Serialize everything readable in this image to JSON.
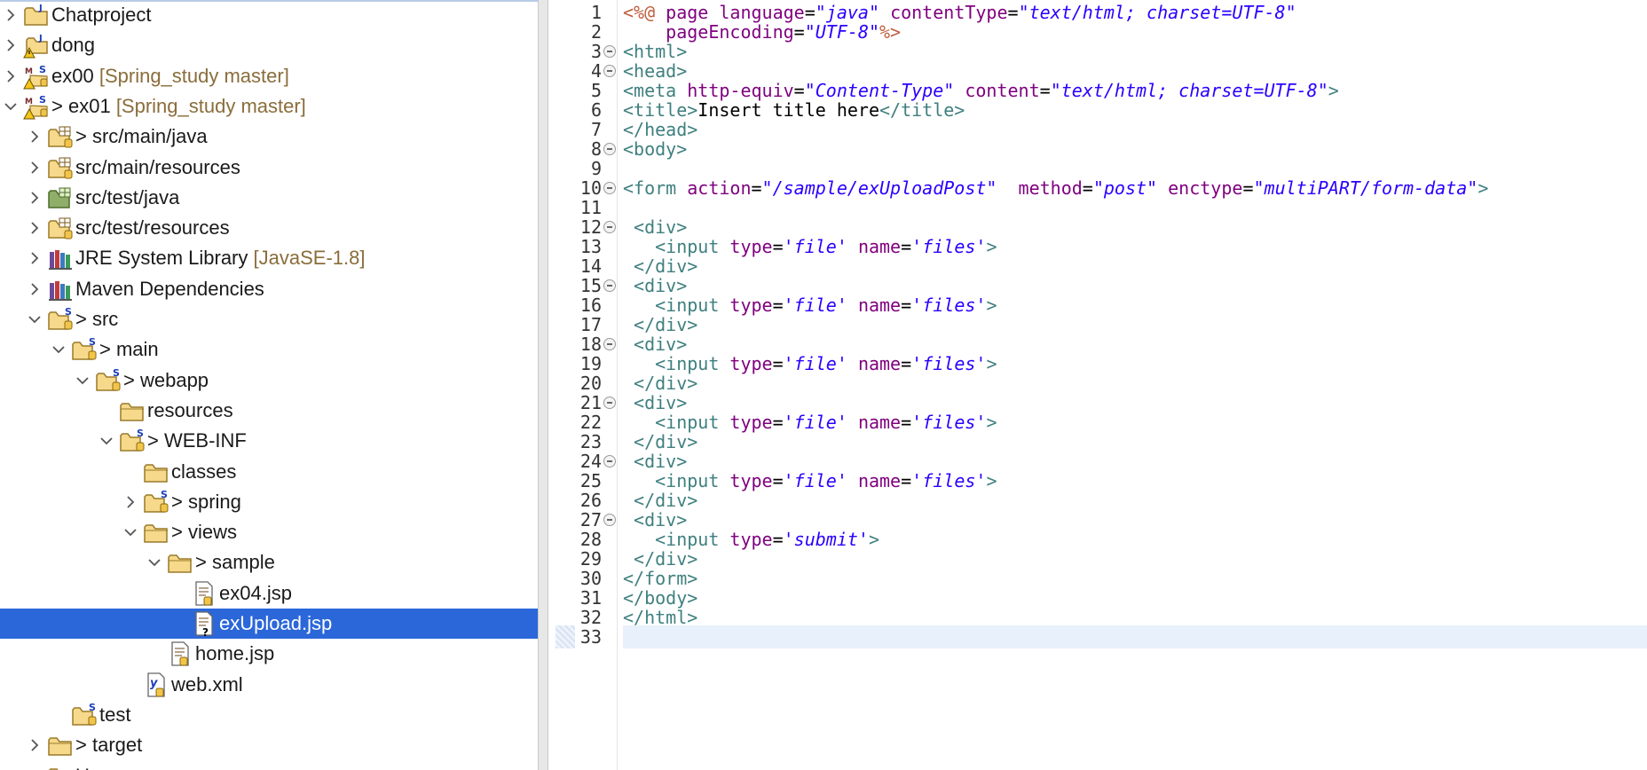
{
  "explorer": {
    "rows": [
      {
        "twisty": "right",
        "icon": "project-icon",
        "prefix": "",
        "label": "Chatproject",
        "decoration": ""
      },
      {
        "twisty": "right",
        "icon": "project-warning-icon",
        "prefix": "",
        "label": "dong",
        "decoration": ""
      },
      {
        "twisty": "right",
        "icon": "maven-project-icon",
        "prefix": "",
        "label": "ex00",
        "decoration": "[Spring_study master]"
      },
      {
        "twisty": "down",
        "icon": "maven-project-icon",
        "prefix": "> ",
        "label": "ex01",
        "decoration": "[Spring_study master]"
      },
      {
        "twisty": "right",
        "icon": "source-folder-icon",
        "prefix": "> ",
        "label": "src/main/java",
        "decoration": ""
      },
      {
        "twisty": "right",
        "icon": "source-folder-icon",
        "prefix": "",
        "label": "src/main/resources",
        "decoration": ""
      },
      {
        "twisty": "right",
        "icon": "test-source-folder-icon",
        "prefix": "",
        "label": "src/test/java",
        "decoration": ""
      },
      {
        "twisty": "right",
        "icon": "source-folder-icon",
        "prefix": "",
        "label": "src/test/resources",
        "decoration": ""
      },
      {
        "twisty": "right",
        "icon": "library-icon",
        "prefix": "",
        "label": "JRE System Library",
        "decoration": "[JavaSE-1.8]"
      },
      {
        "twisty": "right",
        "icon": "library-icon",
        "prefix": "",
        "label": "Maven Dependencies",
        "decoration": ""
      },
      {
        "twisty": "down",
        "icon": "folder-git-icon",
        "prefix": "> ",
        "label": "src",
        "decoration": ""
      },
      {
        "twisty": "down",
        "icon": "folder-git-icon",
        "prefix": "> ",
        "label": "main",
        "decoration": ""
      },
      {
        "twisty": "down",
        "icon": "folder-git-icon",
        "prefix": "> ",
        "label": "webapp",
        "decoration": ""
      },
      {
        "twisty": "none",
        "icon": "folder-icon",
        "prefix": "",
        "label": "resources",
        "decoration": ""
      },
      {
        "twisty": "down",
        "icon": "folder-git-icon",
        "prefix": "> ",
        "label": "WEB-INF",
        "decoration": ""
      },
      {
        "twisty": "none",
        "icon": "folder-icon",
        "prefix": "",
        "label": "classes",
        "decoration": ""
      },
      {
        "twisty": "right",
        "icon": "folder-git-icon",
        "prefix": "> ",
        "label": "spring",
        "decoration": ""
      },
      {
        "twisty": "down",
        "icon": "folder-icon",
        "prefix": "> ",
        "label": "views",
        "decoration": ""
      },
      {
        "twisty": "down",
        "icon": "folder-icon",
        "prefix": "> ",
        "label": "sample",
        "decoration": ""
      },
      {
        "twisty": "none",
        "icon": "jsp-file-icon",
        "prefix": "",
        "label": "ex04.jsp",
        "decoration": ""
      },
      {
        "twisty": "none",
        "icon": "jsp-file-untracked-icon",
        "prefix": "",
        "label": "exUpload.jsp",
        "decoration": "",
        "selected": true
      },
      {
        "twisty": "none",
        "icon": "jsp-file-icon",
        "prefix": "",
        "label": "home.jsp",
        "decoration": ""
      },
      {
        "twisty": "none",
        "icon": "xml-file-icon",
        "prefix": "",
        "label": "web.xml",
        "decoration": ""
      },
      {
        "twisty": "none",
        "icon": "folder-git-icon",
        "prefix": "",
        "label": "test",
        "decoration": ""
      },
      {
        "twisty": "right",
        "icon": "folder-icon",
        "prefix": "> ",
        "label": "target",
        "decoration": ""
      },
      {
        "twisty": "right",
        "icon": "folder-icon",
        "prefix": "",
        "label": "Users",
        "decoration": ""
      }
    ]
  },
  "editor": {
    "lines": [
      {
        "n": "1",
        "fold": false,
        "tokens": [
          [
            "dir",
            "<%@ "
          ],
          [
            "attr",
            "page "
          ],
          [
            "attr",
            "language"
          ],
          [
            "plain",
            "="
          ],
          [
            "val",
            "\"java\""
          ],
          [
            "plain",
            " "
          ],
          [
            "attr",
            "contentType"
          ],
          [
            "plain",
            "="
          ],
          [
            "val",
            "\"text/html; charset=UTF-8\""
          ]
        ]
      },
      {
        "n": "2",
        "fold": false,
        "tokens": [
          [
            "plain",
            "    "
          ],
          [
            "attr",
            "pageEncoding"
          ],
          [
            "plain",
            "="
          ],
          [
            "val",
            "\"UTF-8\""
          ],
          [
            "dir",
            "%>"
          ]
        ]
      },
      {
        "n": "3",
        "fold": true,
        "tokens": [
          [
            "tag",
            "<html>"
          ]
        ]
      },
      {
        "n": "4",
        "fold": true,
        "tokens": [
          [
            "tag",
            "<head>"
          ]
        ]
      },
      {
        "n": "5",
        "fold": false,
        "tokens": [
          [
            "tag",
            "<meta "
          ],
          [
            "attr",
            "http-equiv"
          ],
          [
            "plain",
            "="
          ],
          [
            "val",
            "\"Content-Type\""
          ],
          [
            "plain",
            " "
          ],
          [
            "attr",
            "content"
          ],
          [
            "plain",
            "="
          ],
          [
            "val",
            "\"text/html; charset=UTF-8\""
          ],
          [
            "tag",
            ">"
          ]
        ]
      },
      {
        "n": "6",
        "fold": false,
        "tokens": [
          [
            "tag",
            "<title>"
          ],
          [
            "plain",
            "Insert title here"
          ],
          [
            "tag",
            "</title>"
          ]
        ]
      },
      {
        "n": "7",
        "fold": false,
        "tokens": [
          [
            "tag",
            "</head>"
          ]
        ]
      },
      {
        "n": "8",
        "fold": true,
        "tokens": [
          [
            "tag",
            "<body>"
          ]
        ]
      },
      {
        "n": "9",
        "fold": false,
        "tokens": []
      },
      {
        "n": "10",
        "fold": true,
        "tokens": [
          [
            "tag",
            "<form "
          ],
          [
            "attr",
            "action"
          ],
          [
            "plain",
            "="
          ],
          [
            "val",
            "\"/sample/exUploadPost\""
          ],
          [
            "plain",
            "  "
          ],
          [
            "attr",
            "method"
          ],
          [
            "plain",
            "="
          ],
          [
            "val",
            "\"post\""
          ],
          [
            "plain",
            " "
          ],
          [
            "attr",
            "enctype"
          ],
          [
            "plain",
            "="
          ],
          [
            "val",
            "\"multiPART/form-data\""
          ],
          [
            "tag",
            ">"
          ]
        ]
      },
      {
        "n": "11",
        "fold": false,
        "tokens": []
      },
      {
        "n": "12",
        "fold": true,
        "tokens": [
          [
            "plain",
            " "
          ],
          [
            "tag",
            "<div>"
          ]
        ]
      },
      {
        "n": "13",
        "fold": false,
        "tokens": [
          [
            "plain",
            "   "
          ],
          [
            "tag",
            "<input "
          ],
          [
            "attr",
            "type"
          ],
          [
            "plain",
            "="
          ],
          [
            "val",
            "'file'"
          ],
          [
            "plain",
            " "
          ],
          [
            "attr",
            "name"
          ],
          [
            "plain",
            "="
          ],
          [
            "val",
            "'files'"
          ],
          [
            "tag",
            ">"
          ]
        ]
      },
      {
        "n": "14",
        "fold": false,
        "tokens": [
          [
            "plain",
            " "
          ],
          [
            "tag",
            "</div>"
          ]
        ]
      },
      {
        "n": "15",
        "fold": true,
        "tokens": [
          [
            "plain",
            " "
          ],
          [
            "tag",
            "<div>"
          ]
        ]
      },
      {
        "n": "16",
        "fold": false,
        "tokens": [
          [
            "plain",
            "   "
          ],
          [
            "tag",
            "<input "
          ],
          [
            "attr",
            "type"
          ],
          [
            "plain",
            "="
          ],
          [
            "val",
            "'file'"
          ],
          [
            "plain",
            " "
          ],
          [
            "attr",
            "name"
          ],
          [
            "plain",
            "="
          ],
          [
            "val",
            "'files'"
          ],
          [
            "tag",
            ">"
          ]
        ]
      },
      {
        "n": "17",
        "fold": false,
        "tokens": [
          [
            "plain",
            " "
          ],
          [
            "tag",
            "</div>"
          ]
        ]
      },
      {
        "n": "18",
        "fold": true,
        "tokens": [
          [
            "plain",
            " "
          ],
          [
            "tag",
            "<div>"
          ]
        ]
      },
      {
        "n": "19",
        "fold": false,
        "tokens": [
          [
            "plain",
            "   "
          ],
          [
            "tag",
            "<input "
          ],
          [
            "attr",
            "type"
          ],
          [
            "plain",
            "="
          ],
          [
            "val",
            "'file'"
          ],
          [
            "plain",
            " "
          ],
          [
            "attr",
            "name"
          ],
          [
            "plain",
            "="
          ],
          [
            "val",
            "'files'"
          ],
          [
            "tag",
            ">"
          ]
        ]
      },
      {
        "n": "20",
        "fold": false,
        "tokens": [
          [
            "plain",
            " "
          ],
          [
            "tag",
            "</div>"
          ]
        ]
      },
      {
        "n": "21",
        "fold": true,
        "tokens": [
          [
            "plain",
            " "
          ],
          [
            "tag",
            "<div>"
          ]
        ]
      },
      {
        "n": "22",
        "fold": false,
        "tokens": [
          [
            "plain",
            "   "
          ],
          [
            "tag",
            "<input "
          ],
          [
            "attr",
            "type"
          ],
          [
            "plain",
            "="
          ],
          [
            "val",
            "'file'"
          ],
          [
            "plain",
            " "
          ],
          [
            "attr",
            "name"
          ],
          [
            "plain",
            "="
          ],
          [
            "val",
            "'files'"
          ],
          [
            "tag",
            ">"
          ]
        ]
      },
      {
        "n": "23",
        "fold": false,
        "tokens": [
          [
            "plain",
            " "
          ],
          [
            "tag",
            "</div>"
          ]
        ]
      },
      {
        "n": "24",
        "fold": true,
        "tokens": [
          [
            "plain",
            " "
          ],
          [
            "tag",
            "<div>"
          ]
        ]
      },
      {
        "n": "25",
        "fold": false,
        "tokens": [
          [
            "plain",
            "   "
          ],
          [
            "tag",
            "<input "
          ],
          [
            "attr",
            "type"
          ],
          [
            "plain",
            "="
          ],
          [
            "val",
            "'file'"
          ],
          [
            "plain",
            " "
          ],
          [
            "attr",
            "name"
          ],
          [
            "plain",
            "="
          ],
          [
            "val",
            "'files'"
          ],
          [
            "tag",
            ">"
          ]
        ]
      },
      {
        "n": "26",
        "fold": false,
        "tokens": [
          [
            "plain",
            " "
          ],
          [
            "tag",
            "</div>"
          ]
        ]
      },
      {
        "n": "27",
        "fold": true,
        "tokens": [
          [
            "plain",
            " "
          ],
          [
            "tag",
            "<div>"
          ]
        ]
      },
      {
        "n": "28",
        "fold": false,
        "tokens": [
          [
            "plain",
            "   "
          ],
          [
            "tag",
            "<input "
          ],
          [
            "attr",
            "type"
          ],
          [
            "plain",
            "="
          ],
          [
            "val",
            "'submit'"
          ],
          [
            "tag",
            ">"
          ]
        ]
      },
      {
        "n": "29",
        "fold": false,
        "tokens": [
          [
            "plain",
            " "
          ],
          [
            "tag",
            "</div>"
          ]
        ]
      },
      {
        "n": "30",
        "fold": false,
        "tokens": [
          [
            "tag",
            "</form>"
          ]
        ]
      },
      {
        "n": "31",
        "fold": false,
        "tokens": [
          [
            "tag",
            "</body>"
          ]
        ]
      },
      {
        "n": "32",
        "fold": false,
        "tokens": [
          [
            "tag",
            "</html>"
          ]
        ]
      },
      {
        "n": "33",
        "fold": false,
        "tokens": [],
        "current": true
      }
    ]
  }
}
